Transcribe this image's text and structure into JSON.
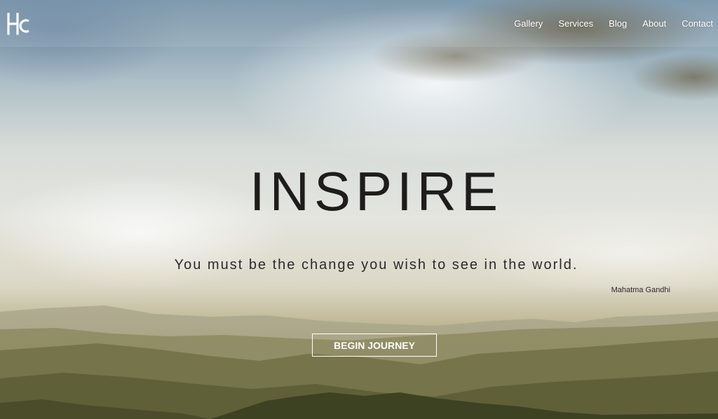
{
  "brand": {
    "logo_text": "HC"
  },
  "nav": {
    "items": [
      {
        "label": "Gallery"
      },
      {
        "label": "Services"
      },
      {
        "label": "Blog"
      },
      {
        "label": "About"
      },
      {
        "label": "Contact"
      }
    ]
  },
  "hero": {
    "title": "INSPIRE",
    "quote": "You must be the change you wish to see in the world.",
    "author": "Mahatma Gandhi",
    "cta_label": "BEGIN JOURNEY"
  },
  "colors": {
    "title_text": "#1f1c1c",
    "nav_text": "#ffffff",
    "cta_border": "#ffffff"
  }
}
